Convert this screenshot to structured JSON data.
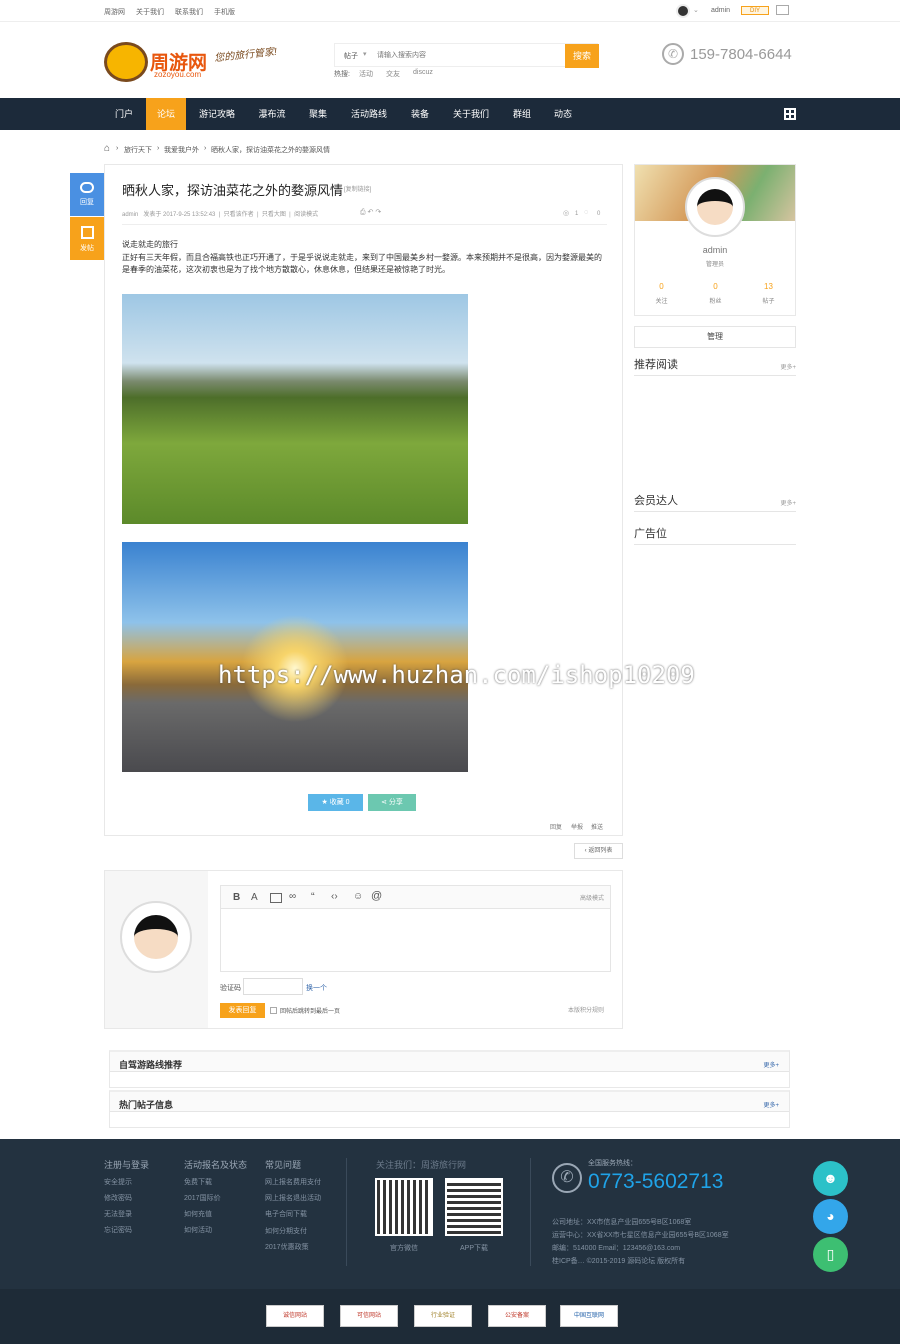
{
  "topbar": {
    "links": [
      "周游网",
      "关于我们",
      "联系我们",
      "手机版"
    ],
    "user": "admin",
    "diy": "DIY"
  },
  "header": {
    "logo_cn": "周游网",
    "logo_en": "zozoyou.com",
    "slogan": "您的旅行管家!",
    "search_type": "帖子",
    "search_placeholder": "请输入搜索内容",
    "search_button": "搜索",
    "hot_label": "热搜:",
    "hot": [
      "活动",
      "交友",
      "discuz"
    ],
    "phone": "159-7804-6644"
  },
  "nav": {
    "items": [
      "门户",
      "论坛",
      "游记攻略",
      "瀑布流",
      "聚集",
      "活动路线",
      "装备",
      "关于我们",
      "群组",
      "动态"
    ],
    "active": 1
  },
  "breadcrumb": [
    "旅行天下",
    "我爱我户外",
    "晒秋人家，探访油菜花之外的婺源风情"
  ],
  "side_buttons": {
    "reply": "回复",
    "post": "发帖"
  },
  "post": {
    "title": "晒秋人家，探访油菜花之外的婺源风情",
    "copy_link": "[复制链接]",
    "meta": "admin   发表于 2017-9-25 13:52:43  |  只看该作者  |  只看大图  |  阅读模式",
    "views": "1",
    "replies": "0",
    "body_line1": "说走就走的旅行",
    "body_line2": "正好有三天年假，而且合福高铁也正巧开通了，于是乎说说走就走，来到了中国最美乡村一婺源。本来预期并不是很高，因为婺源最美的是春季的油菜花，这次初衷也是为了找个地方散散心，休息休息，但结果还是被惊艳了时光。",
    "collect": "收藏 0",
    "share": "分享",
    "actions": [
      "回复",
      "举报",
      "推送"
    ],
    "back": "返回列表"
  },
  "watermark": "https://www.huzhan.com/ishop10209",
  "editor": {
    "mode": "高级模式",
    "captcha_label": "验证码",
    "captcha_change": "换一个",
    "submit": "发表回复",
    "checkbox_label": "回帖后跳转到最后一页",
    "reward": "本版积分规则"
  },
  "sidebar": {
    "user": "admin",
    "role": "管理员",
    "stats": [
      {
        "n": "0",
        "l": "关注"
      },
      {
        "n": "0",
        "l": "粉丝"
      },
      {
        "n": "13",
        "l": "帖子"
      }
    ],
    "manage": "管理",
    "sections": [
      {
        "title": "推荐阅读",
        "more": "更多+"
      },
      {
        "title": "会员达人",
        "more": "更多+"
      },
      {
        "title": "广告位",
        "more": ""
      }
    ]
  },
  "bottom_sections": [
    {
      "title": "自驾游路线推荐",
      "more": "更多+"
    },
    {
      "title": "热门帖子信息",
      "more": "更多+"
    }
  ],
  "footer": {
    "cols": [
      {
        "h": "注册与登录",
        "items": [
          "安全提示",
          "修改密码",
          "无法登录",
          "忘记密码"
        ]
      },
      {
        "h": "活动报名及状态",
        "items": [
          "免费下载",
          "2017国际价",
          "如何充值",
          "如何活动"
        ]
      },
      {
        "h": "常见问题",
        "items": [
          "网上报名费用支付",
          "网上报名退出活动",
          "电子合同下载",
          "如何分期支付",
          "2017优惠政策"
        ]
      }
    ],
    "follow": "关注我们：周游旅行网",
    "qr": [
      "官方微信",
      "APP下载"
    ],
    "hotline_label": "全国服务热线：",
    "hotline": "0773-5602713",
    "addr1": "公司地址：XX市信息产业园655号B区1068室",
    "addr2": "运营中心：XX省XX市七星区信息产业园655号B区1068室",
    "addr3": "邮编：514000  Email：123456@163.com",
    "copy": "桂ICP备…  ©2015-2019  源码论坛  版权所有",
    "badges": [
      "诚信网站",
      "可信网站",
      "行业验证",
      "公安备案",
      "中国互联网"
    ]
  },
  "colors": {
    "nav": "#1c2a3a",
    "accent": "#f7a21b",
    "footer": "#233240"
  }
}
